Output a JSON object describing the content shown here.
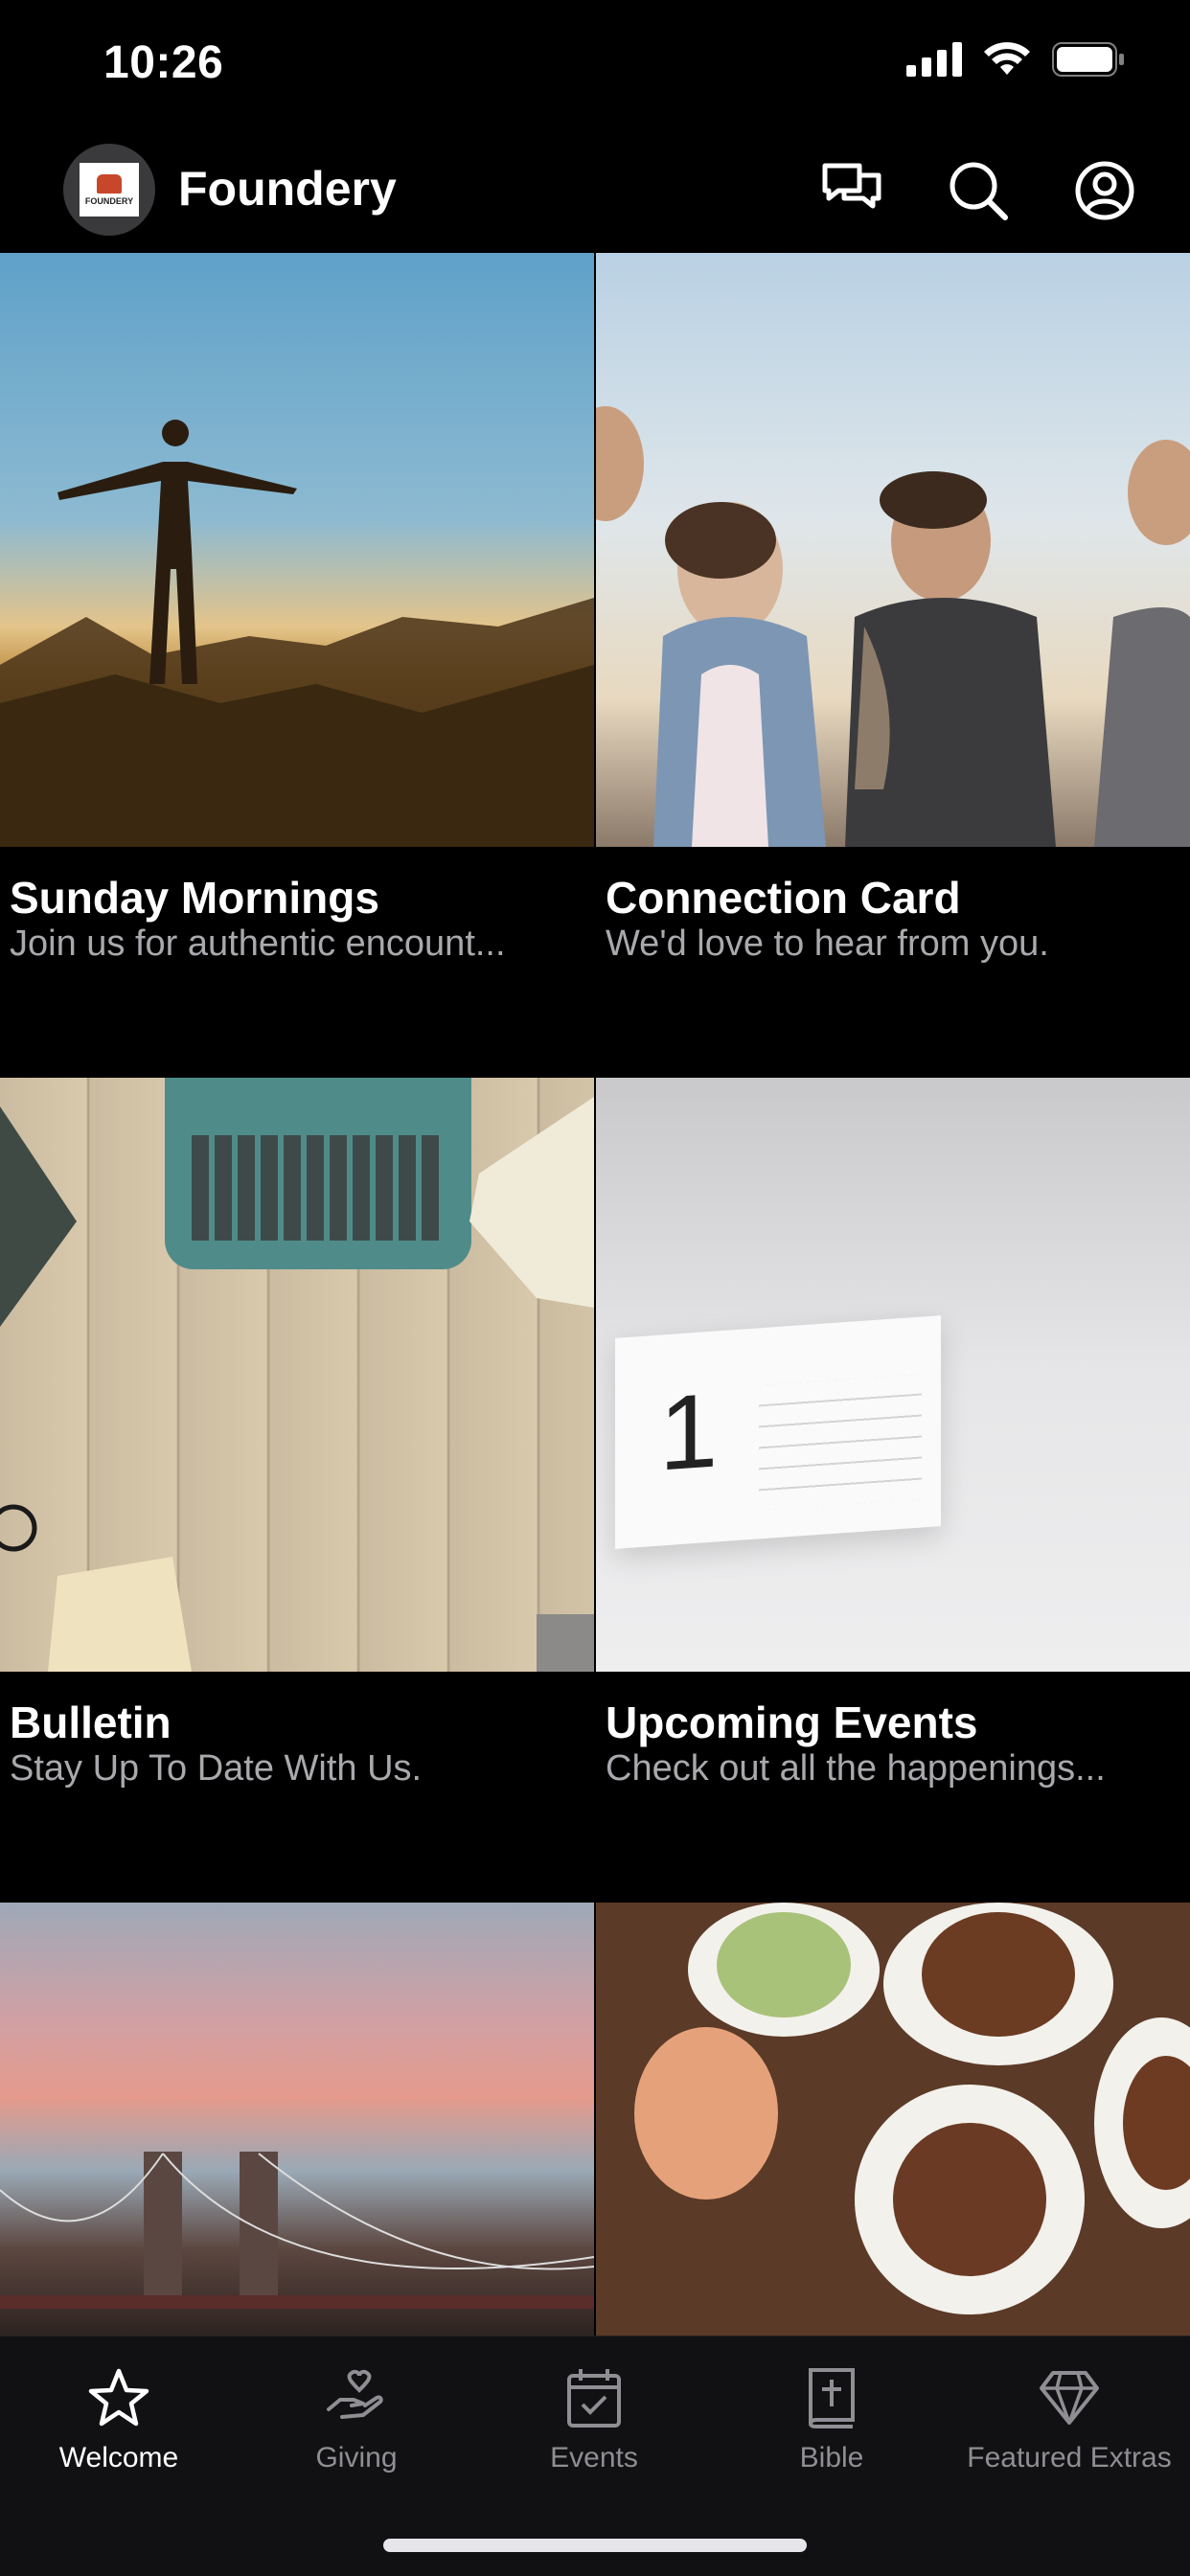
{
  "status_bar": {
    "time": "10:26"
  },
  "header": {
    "logo_text": "FOUNDERY",
    "title": "Foundery",
    "icons": [
      "messages-icon",
      "search-icon",
      "profile-icon"
    ]
  },
  "tiles": [
    {
      "title": "Sunday Mornings",
      "subtitle": "Join us for authentic encount..."
    },
    {
      "title": "Connection Card",
      "subtitle": "We'd love to hear from you."
    },
    {
      "title": "Bulletin",
      "subtitle": "Stay Up To Date With Us."
    },
    {
      "title": "Upcoming Events",
      "subtitle": "Check out all the happenings..."
    }
  ],
  "calendar": {
    "day": "1"
  },
  "tabbar": {
    "items": [
      {
        "label": "Welcome",
        "icon": "star-icon",
        "active": true
      },
      {
        "label": "Giving",
        "icon": "giving-hand-icon",
        "active": false
      },
      {
        "label": "Events",
        "icon": "calendar-check-icon",
        "active": false
      },
      {
        "label": "Bible",
        "icon": "bible-icon",
        "active": false
      },
      {
        "label": "Featured Extras",
        "icon": "diamond-icon",
        "active": false
      }
    ]
  },
  "colors": {
    "background": "#000000",
    "subtitle": "#a9a9ad",
    "tab_inactive": "#8e8e93",
    "tabbar_bg": "#111113"
  }
}
